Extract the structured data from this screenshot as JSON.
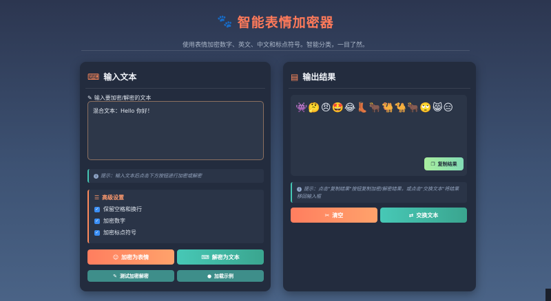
{
  "header": {
    "title": "智能表情加密器",
    "subtitle": "使用表情加密数字、英文、中文和标点符号。智能分类，一目了然。"
  },
  "input_panel": {
    "title": "输入文本",
    "field_label": "输入要加密/解密的文本",
    "textarea_value": "混合文本：Hello 你好！",
    "hint": "提示：输入文本后点击下方按钮进行加密或解密",
    "advanced": {
      "title": "高级设置",
      "options": [
        {
          "label": "保留空格和换行",
          "checked": true
        },
        {
          "label": "加密数字",
          "checked": true
        },
        {
          "label": "加密标点符号",
          "checked": true
        }
      ]
    },
    "buttons": {
      "encrypt": "加密为表情",
      "decrypt": "解密为文本",
      "test": "测试加密解密",
      "example": "加载示例"
    }
  },
  "output_panel": {
    "title": "输出结果",
    "output_emojis": "👾🤔😠🤩😂👢🐂🐫🐪🐂🙄😸😑",
    "copy_button": "复制结果",
    "hint": "提示：点击\"复制结果\"按钮复制加密/解密结果，或点击\"交换文本\"将结果移回输入框",
    "buttons": {
      "clear": "清空",
      "swap": "交换文本"
    }
  },
  "colors": {
    "accent": "#ff7a5a",
    "teal": "#47c8b6",
    "panel": "#232c3e"
  }
}
